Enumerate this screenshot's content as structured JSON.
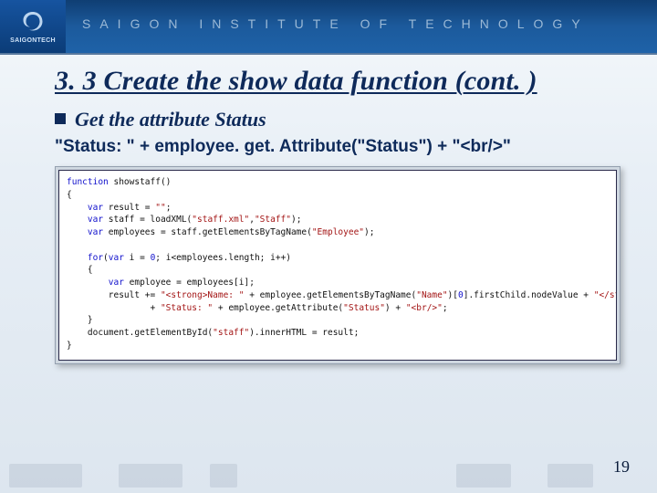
{
  "header": {
    "logo_label": "SAIGONTECH",
    "institute_text": "SAIGON INSTITUTE OF TECHNOLOGY"
  },
  "title": "3. 3 Create the show data function (cont. )",
  "bullet": {
    "text": "Get the attribute Status"
  },
  "inline_code": "\"Status: \" + employee. get. Attribute(\"Status\") + \"<br/>\"",
  "code_block": {
    "l01a": "function",
    "l01b": " showstaff()",
    "l02": "{",
    "l03a": "    var",
    "l03b": " result = ",
    "l03c": "\"\"",
    "l03d": ";",
    "l04a": "    var",
    "l04b": " staff = loadXML(",
    "l04c": "\"staff.xml\"",
    "l04d": ",",
    "l04e": "\"Staff\"",
    "l04f": ");",
    "l05a": "    var",
    "l05b": " employees = staff.getElementsByTagName(",
    "l05c": "\"Employee\"",
    "l05d": ");",
    "l06": "",
    "l07a": "    for",
    "l07b": "(",
    "l07c": "var",
    "l07d": " i = ",
    "l07e": "0",
    "l07f": "; i<employees.length; i++)",
    "l08": "    {",
    "l09a": "        var",
    "l09b": " employee = employees[i];",
    "l10a": "        result += ",
    "l10b": "\"<strong>Name: \"",
    "l10c": " + employee.getElementsByTagName(",
    "l10d": "\"Name\"",
    "l10e": ")[",
    "l10f": "0",
    "l10g": "].firstChild.nodeValue + ",
    "l10h": "\"</strong><br/>\"",
    "l11a": "                + ",
    "l11b": "\"Status: \"",
    "l11c": " + employee.getAttribute(",
    "l11d": "\"Status\"",
    "l11e": ") + ",
    "l11f": "\"<br/>\"",
    "l11g": ";",
    "l12": "    }",
    "l13a": "    document.getElementById(",
    "l13b": "\"staff\"",
    "l13c": ").innerHTML = result;",
    "l14": "}"
  },
  "page_number": "19"
}
